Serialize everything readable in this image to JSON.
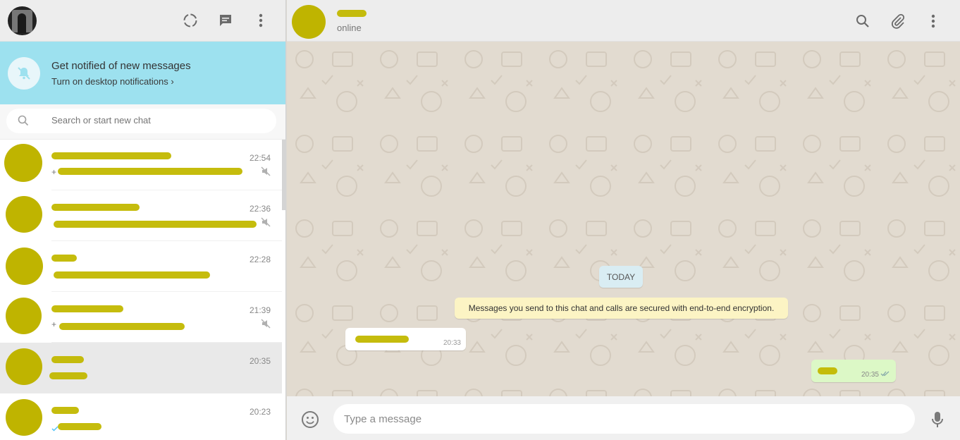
{
  "sidebar_header": {
    "icons": [
      "avatar",
      "status-icon",
      "new-chat-icon",
      "menu-icon"
    ]
  },
  "notification_banner": {
    "title": "Get notified of new messages",
    "link": "Turn on desktop notifications ›"
  },
  "search": {
    "placeholder": "Search or start new chat"
  },
  "chats": [
    {
      "time": "22:54",
      "muted": true,
      "preview_prefix": "+"
    },
    {
      "time": "22:36",
      "muted": true,
      "preview_prefix": ""
    },
    {
      "time": "22:28",
      "muted": false,
      "preview_prefix": ""
    },
    {
      "time": "21:39",
      "muted": true,
      "preview_prefix": "+"
    },
    {
      "time": "20:35",
      "muted": false,
      "preview_prefix": ""
    },
    {
      "time": "20:23",
      "muted": false,
      "preview_prefix": ""
    }
  ],
  "conversation": {
    "status": "online",
    "day_label": "TODAY",
    "encryption_notice": "Messages you send to this chat and calls are secured with end-to-end encryption.",
    "incoming": {
      "time": "20:33"
    },
    "outgoing": {
      "time": "20:35"
    }
  },
  "composer": {
    "placeholder": "Type a message"
  },
  "colors": {
    "banner": "#9de1ef",
    "redaction": "#c2b800",
    "outgoing_bubble": "#dcf8c6",
    "encryption_bubble": "#fcf4c4"
  }
}
